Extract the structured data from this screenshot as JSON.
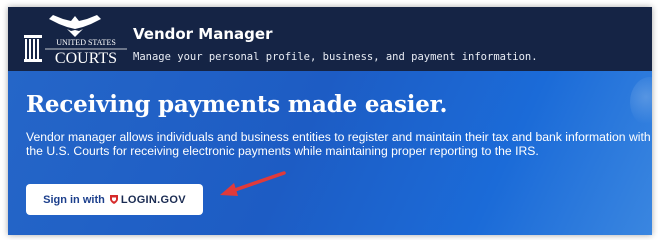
{
  "header": {
    "seal_text_top": "UNITED STATES",
    "seal_text_bottom": "COURTS",
    "title": "Vendor Manager",
    "subtitle": "Manage your personal profile, business, and payment information."
  },
  "hero": {
    "title": "Receiving payments made easier.",
    "body": "Vendor manager allows individuals and business entities to register and maintain their tax and bank information with the U.S. Courts for receiving electronic payments while maintaining proper reporting to the IRS."
  },
  "signin": {
    "prefix": "Sign in with",
    "brand": "LOGIN.GOV"
  },
  "colors": {
    "header_bg": "#152445",
    "hero_bg": "#1d5cc4",
    "annotation_arrow": "#e03a3a",
    "login_shield": "#d62b2b"
  },
  "icons": {
    "logo": "us-courts-eagle-logo",
    "shield": "login-gov-shield-icon",
    "annotation": "red-arrow-annotation"
  }
}
